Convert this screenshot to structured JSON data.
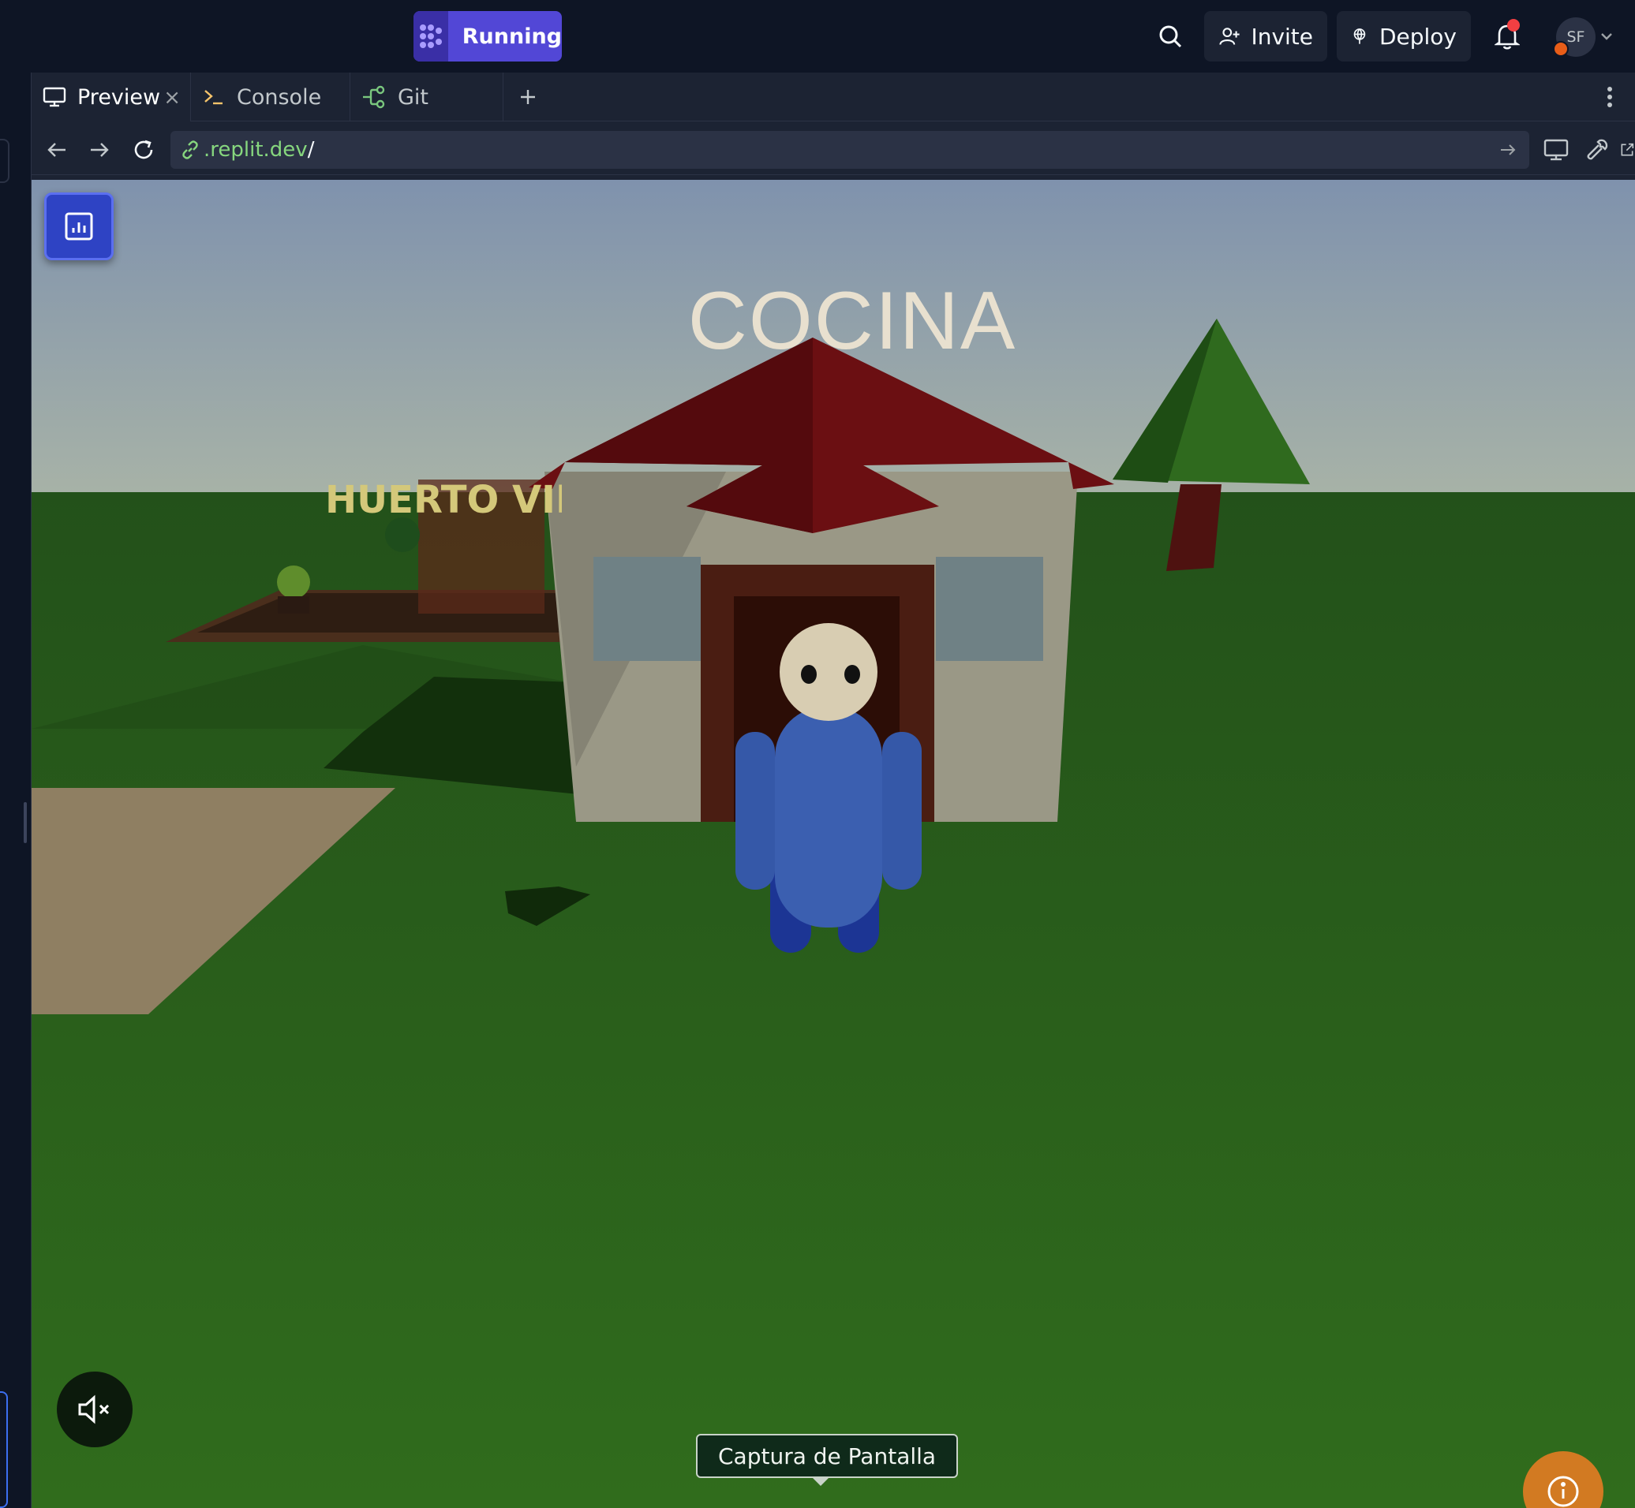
{
  "topbar": {
    "run_label": "Running",
    "invite_label": "Invite",
    "deploy_label": "Deploy",
    "avatar_initials": "SF"
  },
  "tabs": [
    {
      "label": "Preview",
      "icon": "monitor-icon",
      "active": true
    },
    {
      "label": "Console",
      "icon": "terminal-icon",
      "active": false
    },
    {
      "label": "Git",
      "icon": "git-branch-icon",
      "active": false
    }
  ],
  "urlbar": {
    "host": ".replit.dev",
    "path": "/"
  },
  "game": {
    "building_label": "COCINA",
    "garden_label": "HUERTO VIR",
    "tooltip": "Captura de Pantalla"
  },
  "colors": {
    "run_button": "#5247d6",
    "sky": "#8094ab",
    "grass": "#2d6a1c",
    "roof": "#6b0f12",
    "character_body": "#3b5fb0",
    "stats_button": "#2e43c4",
    "info_button": "#d27a22"
  }
}
